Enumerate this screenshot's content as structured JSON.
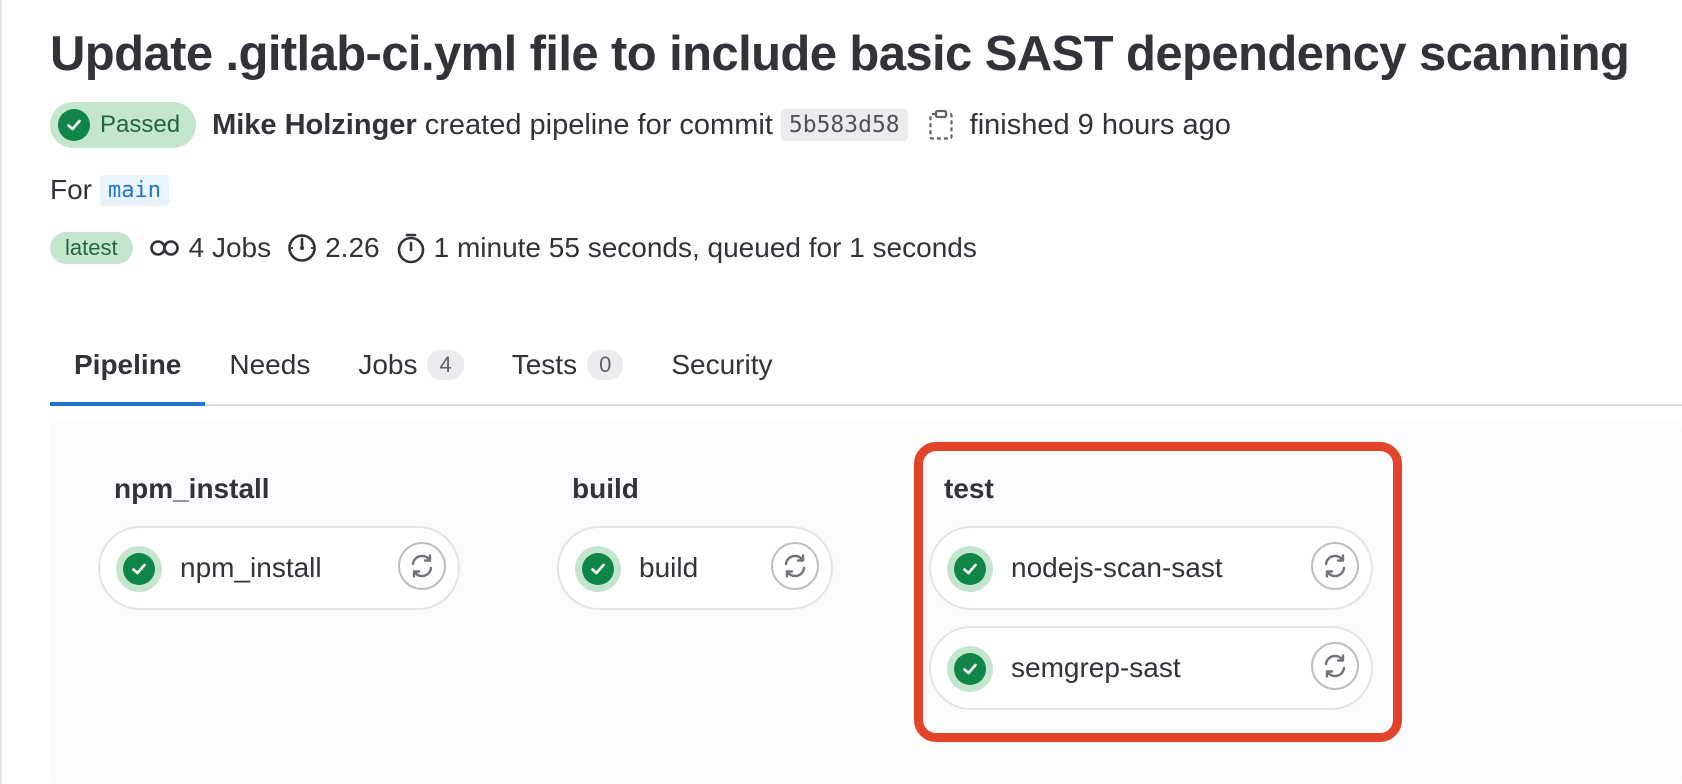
{
  "header": {
    "title": "Update .gitlab-ci.yml file to include basic SAST dependency scanning",
    "status_label": "Passed",
    "author": "Mike Holzinger",
    "created_text": "created pipeline for commit",
    "commit_sha": "5b583d58",
    "finished_text": "finished 9 hours ago",
    "for_label": "For",
    "ref": "main"
  },
  "meta": {
    "latest_badge": "latest",
    "jobs": "4 Jobs",
    "compute": "2.26",
    "duration": "1 minute 55 seconds, queued for 1 seconds"
  },
  "tabs": [
    {
      "label": "Pipeline",
      "active": true
    },
    {
      "label": "Needs"
    },
    {
      "label": "Jobs",
      "count": "4"
    },
    {
      "label": "Tests",
      "count": "0"
    },
    {
      "label": "Security"
    }
  ],
  "stages": [
    {
      "title": "npm_install",
      "jobs": [
        {
          "name": "npm_install",
          "status": "passed"
        }
      ]
    },
    {
      "title": "build",
      "jobs": [
        {
          "name": "build",
          "status": "passed"
        }
      ]
    },
    {
      "title": "test",
      "jobs": [
        {
          "name": "nodejs-scan-sast",
          "status": "passed"
        },
        {
          "name": "semgrep-sast",
          "status": "passed"
        }
      ]
    }
  ],
  "icons": {
    "status": "check-circle-icon",
    "copy": "copy-to-clipboard-icon",
    "jobs": "pipeline-link-icon",
    "compute": "gauge-icon",
    "duration": "timer-icon",
    "retry": "retry-icon"
  },
  "colors": {
    "success": "#108548",
    "success_bg": "#c3e6cd",
    "active_tab": "#1f75cb",
    "highlight": "#e24329"
  }
}
